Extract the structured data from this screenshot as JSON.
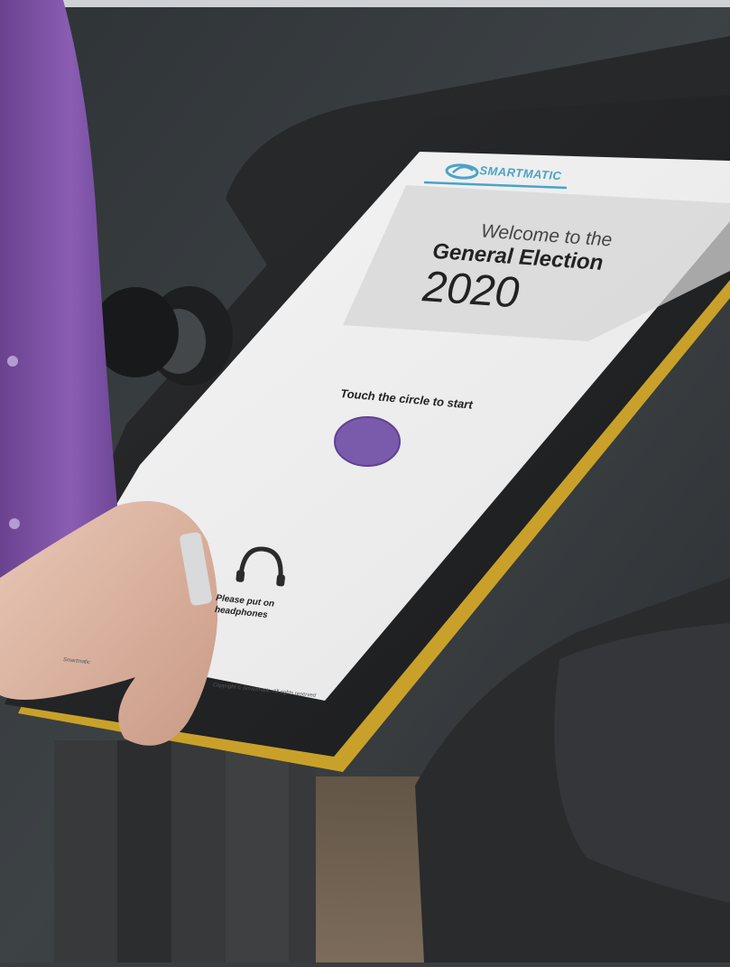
{
  "brand": {
    "logo_text": "SMARTMATIC"
  },
  "welcome": {
    "line1": "Welcome to the",
    "line2": "General Election",
    "year": "2020"
  },
  "start": {
    "prompt": "Touch the circle to start",
    "circle_color": "#7a5aab"
  },
  "headphones": {
    "line1": "Please put on",
    "line2": "headphones",
    "icon": "headphones-icon"
  },
  "footer": {
    "left": "Smartmatic",
    "right": "Copyright © Smartmatic. All rights reserved"
  },
  "colors": {
    "bezel_trim": "#c9a12a",
    "sleeve": "#7a4fa0",
    "accent": "#4ba3c7"
  }
}
